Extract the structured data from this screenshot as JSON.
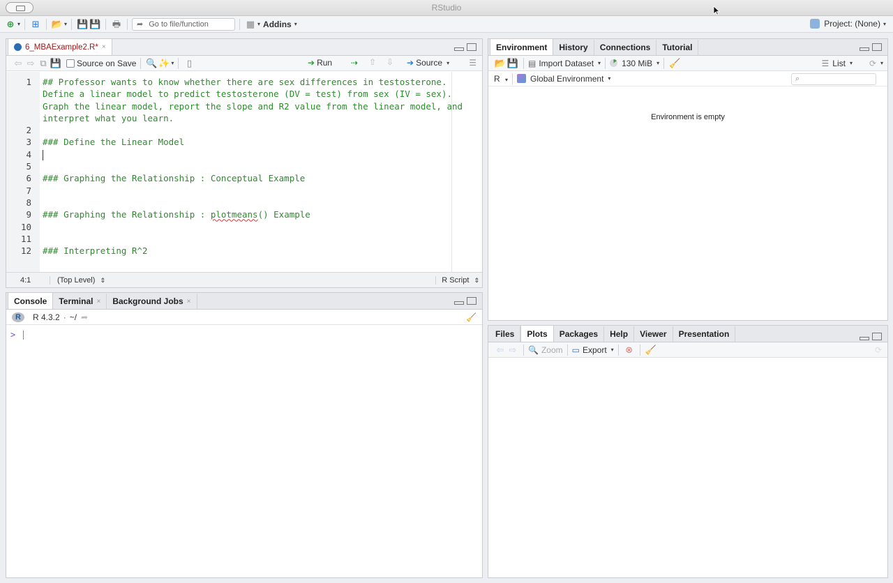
{
  "window": {
    "title": "RStudio"
  },
  "toolbar": {
    "goto_placeholder": "Go to file/function",
    "addins_label": "Addins",
    "project_label": "Project: (None)"
  },
  "editor": {
    "tab_label": "6_MBAExample2.R*",
    "source_on_save": "Source on Save",
    "run_label": "Run",
    "source_label": "Source",
    "lines": [
      "## Professor wants to know whether there are sex differences in testosterone. Define a linear model to predict testosterone (DV = test) from sex (IV = sex). Graph the linear model, report the slope and R2 value from the linear model, and interpret what you learn.",
      "",
      "### Define the Linear Model",
      "",
      "",
      "### Graphing the Relationship : Conceptual Example",
      "",
      "",
      "### Graphing the Relationship : plotmeans() Example",
      "",
      "",
      "### Interpreting R^2"
    ],
    "line_numbers": [
      "1",
      "2",
      "3",
      "4",
      "5",
      "6",
      "7",
      "8",
      "9",
      "10",
      "11",
      "12"
    ],
    "status_position": "4:1",
    "status_scope": "(Top Level)",
    "status_type": "R Script"
  },
  "console": {
    "tabs": [
      "Console",
      "Terminal",
      "Background Jobs"
    ],
    "version": "R 4.3.2",
    "path": "~/",
    "prompt": ">"
  },
  "environment": {
    "tabs": [
      "Environment",
      "History",
      "Connections",
      "Tutorial"
    ],
    "import_label": "Import Dataset",
    "memory": "130 MiB",
    "list_label": "List",
    "r_label": "R",
    "scope_label": "Global Environment",
    "empty_message": "Environment is empty"
  },
  "files": {
    "tabs": [
      "Files",
      "Plots",
      "Packages",
      "Help",
      "Viewer",
      "Presentation"
    ],
    "zoom_label": "Zoom",
    "export_label": "Export"
  },
  "colors": {
    "comment_green": "#2f8a2f",
    "prompt_purple": "#7a4bd0",
    "tab_label_red": "#a01818"
  }
}
